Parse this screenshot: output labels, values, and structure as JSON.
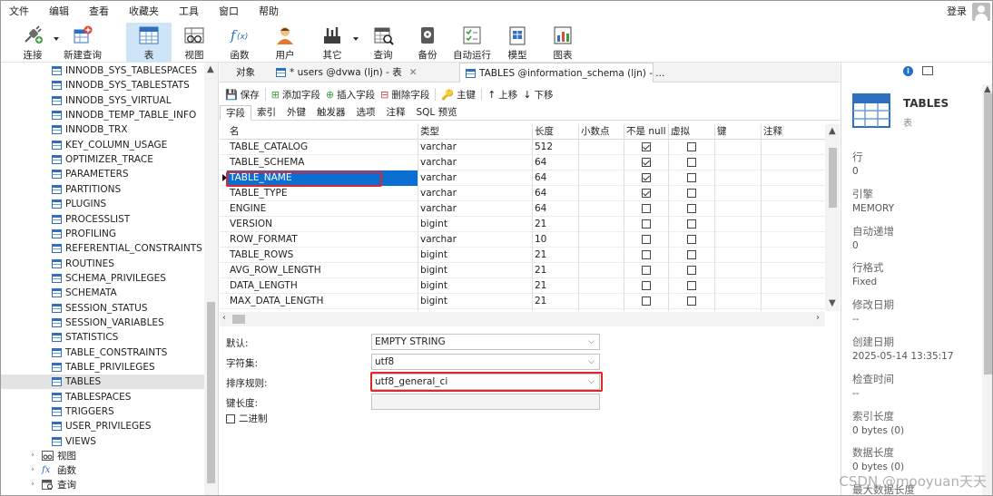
{
  "menubar": {
    "items": [
      "文件",
      "编辑",
      "查看",
      "收藏夹",
      "工具",
      "窗口",
      "帮助"
    ],
    "login": "登录"
  },
  "toolbar": {
    "buttons": [
      "连接",
      "新建查询",
      "表",
      "视图",
      "函数",
      "用户",
      "其它",
      "查询",
      "备份",
      "自动运行",
      "模型",
      "图表"
    ],
    "active": "表"
  },
  "nav": {
    "items": [
      "INNODB_SYS_TABLESPACES",
      "INNODB_SYS_TABLESTATS",
      "INNODB_SYS_VIRTUAL",
      "INNODB_TEMP_TABLE_INFO",
      "INNODB_TRX",
      "KEY_COLUMN_USAGE",
      "OPTIMIZER_TRACE",
      "PARAMETERS",
      "PARTITIONS",
      "PLUGINS",
      "PROCESSLIST",
      "PROFILING",
      "REFERENTIAL_CONSTRAINTS",
      "ROUTINES",
      "SCHEMA_PRIVILEGES",
      "SCHEMATA",
      "SESSION_STATUS",
      "SESSION_VARIABLES",
      "STATISTICS",
      "TABLE_CONSTRAINTS",
      "TABLE_PRIVILEGES",
      "TABLES",
      "TABLESPACES",
      "TRIGGERS",
      "USER_PRIVILEGES",
      "VIEWS"
    ],
    "selected": "TABLES",
    "groups": [
      {
        "label": "视图",
        "icon": "view-icon"
      },
      {
        "label": "函数",
        "icon": "function-icon"
      },
      {
        "label": "查询",
        "icon": "query-icon"
      }
    ]
  },
  "tabs": [
    {
      "label": "对象"
    },
    {
      "label": "* users @dvwa (ljn) - 表"
    },
    {
      "label": "TABLES @information_schema (ljn) - ..."
    }
  ],
  "editor_toolbar": [
    "保存",
    "添加字段",
    "插入字段",
    "删除字段",
    "主键",
    "上移",
    "下移"
  ],
  "subtabs": [
    "字段",
    "索引",
    "外键",
    "触发器",
    "选项",
    "注释",
    "SQL 预览"
  ],
  "grid": {
    "headers": [
      "名",
      "类型",
      "长度",
      "小数点",
      "不是 null",
      "虚拟",
      "键",
      "注释"
    ],
    "rows": [
      {
        "name": "TABLE_CATALOG",
        "type": "varchar",
        "length": "512",
        "notnull": true,
        "virtual": false
      },
      {
        "name": "TABLE_SCHEMA",
        "type": "varchar",
        "length": "64",
        "notnull": true,
        "virtual": false
      },
      {
        "name": "TABLE_NAME",
        "type": "varchar",
        "length": "64",
        "notnull": true,
        "virtual": false
      },
      {
        "name": "TABLE_TYPE",
        "type": "varchar",
        "length": "64",
        "notnull": true,
        "virtual": false
      },
      {
        "name": "ENGINE",
        "type": "varchar",
        "length": "64",
        "notnull": false,
        "virtual": false
      },
      {
        "name": "VERSION",
        "type": "bigint",
        "length": "21",
        "notnull": false,
        "virtual": false
      },
      {
        "name": "ROW_FORMAT",
        "type": "varchar",
        "length": "10",
        "notnull": false,
        "virtual": false
      },
      {
        "name": "TABLE_ROWS",
        "type": "bigint",
        "length": "21",
        "notnull": false,
        "virtual": false
      },
      {
        "name": "AVG_ROW_LENGTH",
        "type": "bigint",
        "length": "21",
        "notnull": false,
        "virtual": false
      },
      {
        "name": "DATA_LENGTH",
        "type": "bigint",
        "length": "21",
        "notnull": false,
        "virtual": false
      },
      {
        "name": "MAX_DATA_LENGTH",
        "type": "bigint",
        "length": "21",
        "notnull": false,
        "virtual": false
      }
    ],
    "selected_row": "TABLE_NAME"
  },
  "props": {
    "default_label": "默认:",
    "default_value": "EMPTY STRING",
    "charset_label": "字符集:",
    "charset_value": "utf8",
    "collation_label": "排序规则:",
    "collation_value": "utf8_general_ci",
    "keylen_label": "键长度:",
    "binary_label": "二进制"
  },
  "info": {
    "title": "TABLES",
    "subtitle": "表",
    "fields": [
      {
        "label": "行",
        "value": "0"
      },
      {
        "label": "引擎",
        "value": "MEMORY"
      },
      {
        "label": "自动递增",
        "value": "0"
      },
      {
        "label": "行格式",
        "value": "Fixed"
      },
      {
        "label": "修改日期",
        "value": "--"
      },
      {
        "label": "创建日期",
        "value": "2025-05-14 13:35:17"
      },
      {
        "label": "检查时间",
        "value": "--"
      },
      {
        "label": "索引长度",
        "value": "0 bytes (0)"
      },
      {
        "label": "数据长度",
        "value": "0 bytes (0)"
      },
      {
        "label": "最大数据长度",
        "value": ""
      }
    ]
  },
  "watermark": "CSDN @mooyuan天天",
  "colors": {
    "accent": "#0b6fd1",
    "highlight_box": "#e0262a",
    "active_tool_bg": "#cfe5f7"
  }
}
